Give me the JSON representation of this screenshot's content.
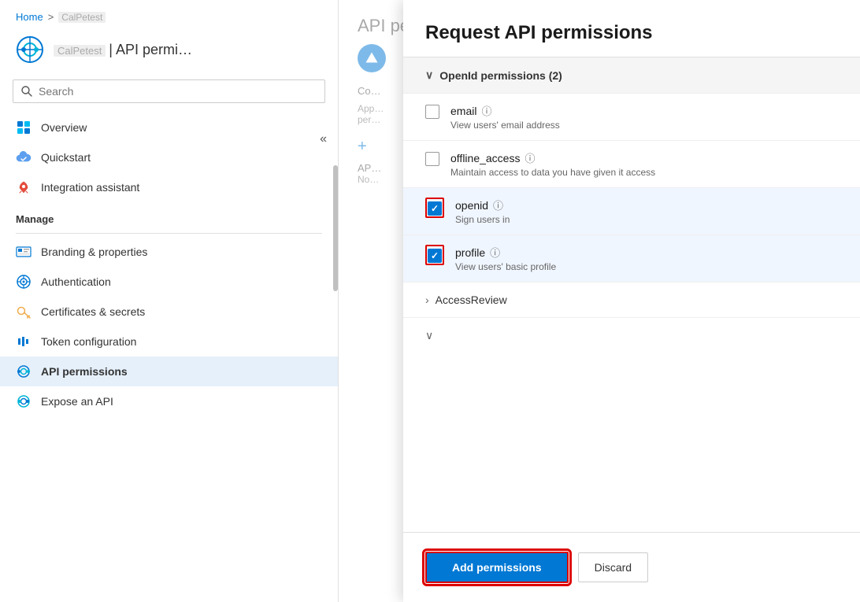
{
  "breadcrumb": {
    "home": "Home",
    "separator": ">",
    "current": "CalPetest"
  },
  "app": {
    "name": "CalPetest",
    "title": "| API permi…"
  },
  "search": {
    "placeholder": "Search",
    "label": "Search"
  },
  "nav": {
    "items": [
      {
        "id": "overview",
        "label": "Overview",
        "icon": "grid-icon"
      },
      {
        "id": "quickstart",
        "label": "Quickstart",
        "icon": "cloud-icon"
      },
      {
        "id": "integration",
        "label": "Integration assistant",
        "icon": "rocket-icon"
      }
    ],
    "manage_label": "Manage",
    "manage_items": [
      {
        "id": "branding",
        "label": "Branding & properties",
        "icon": "branding-icon"
      },
      {
        "id": "authentication",
        "label": "Authentication",
        "icon": "auth-icon"
      },
      {
        "id": "certificates",
        "label": "Certificates & secrets",
        "icon": "key-icon"
      },
      {
        "id": "token",
        "label": "Token configuration",
        "icon": "token-icon"
      },
      {
        "id": "api-permissions",
        "label": "API permissions",
        "icon": "api-icon",
        "active": true
      },
      {
        "id": "expose-api",
        "label": "Expose an API",
        "icon": "expose-icon"
      }
    ]
  },
  "drawer": {
    "title": "Request API permissions",
    "openid_section": {
      "label": "OpenId permissions (2)",
      "items": [
        {
          "id": "email",
          "name": "email",
          "desc": "View users' email address",
          "checked": false,
          "selected": false
        },
        {
          "id": "offline_access",
          "name": "offline_access",
          "desc": "Maintain access to data you have given it access",
          "checked": false,
          "selected": false
        },
        {
          "id": "openid",
          "name": "openid",
          "desc": "Sign users in",
          "checked": true,
          "selected": true
        },
        {
          "id": "profile",
          "name": "profile",
          "desc": "View users' basic profile",
          "checked": true,
          "selected": true
        }
      ]
    },
    "access_review": "AccessReview",
    "add_button": "Add permissions",
    "discard_button": "Discard"
  }
}
